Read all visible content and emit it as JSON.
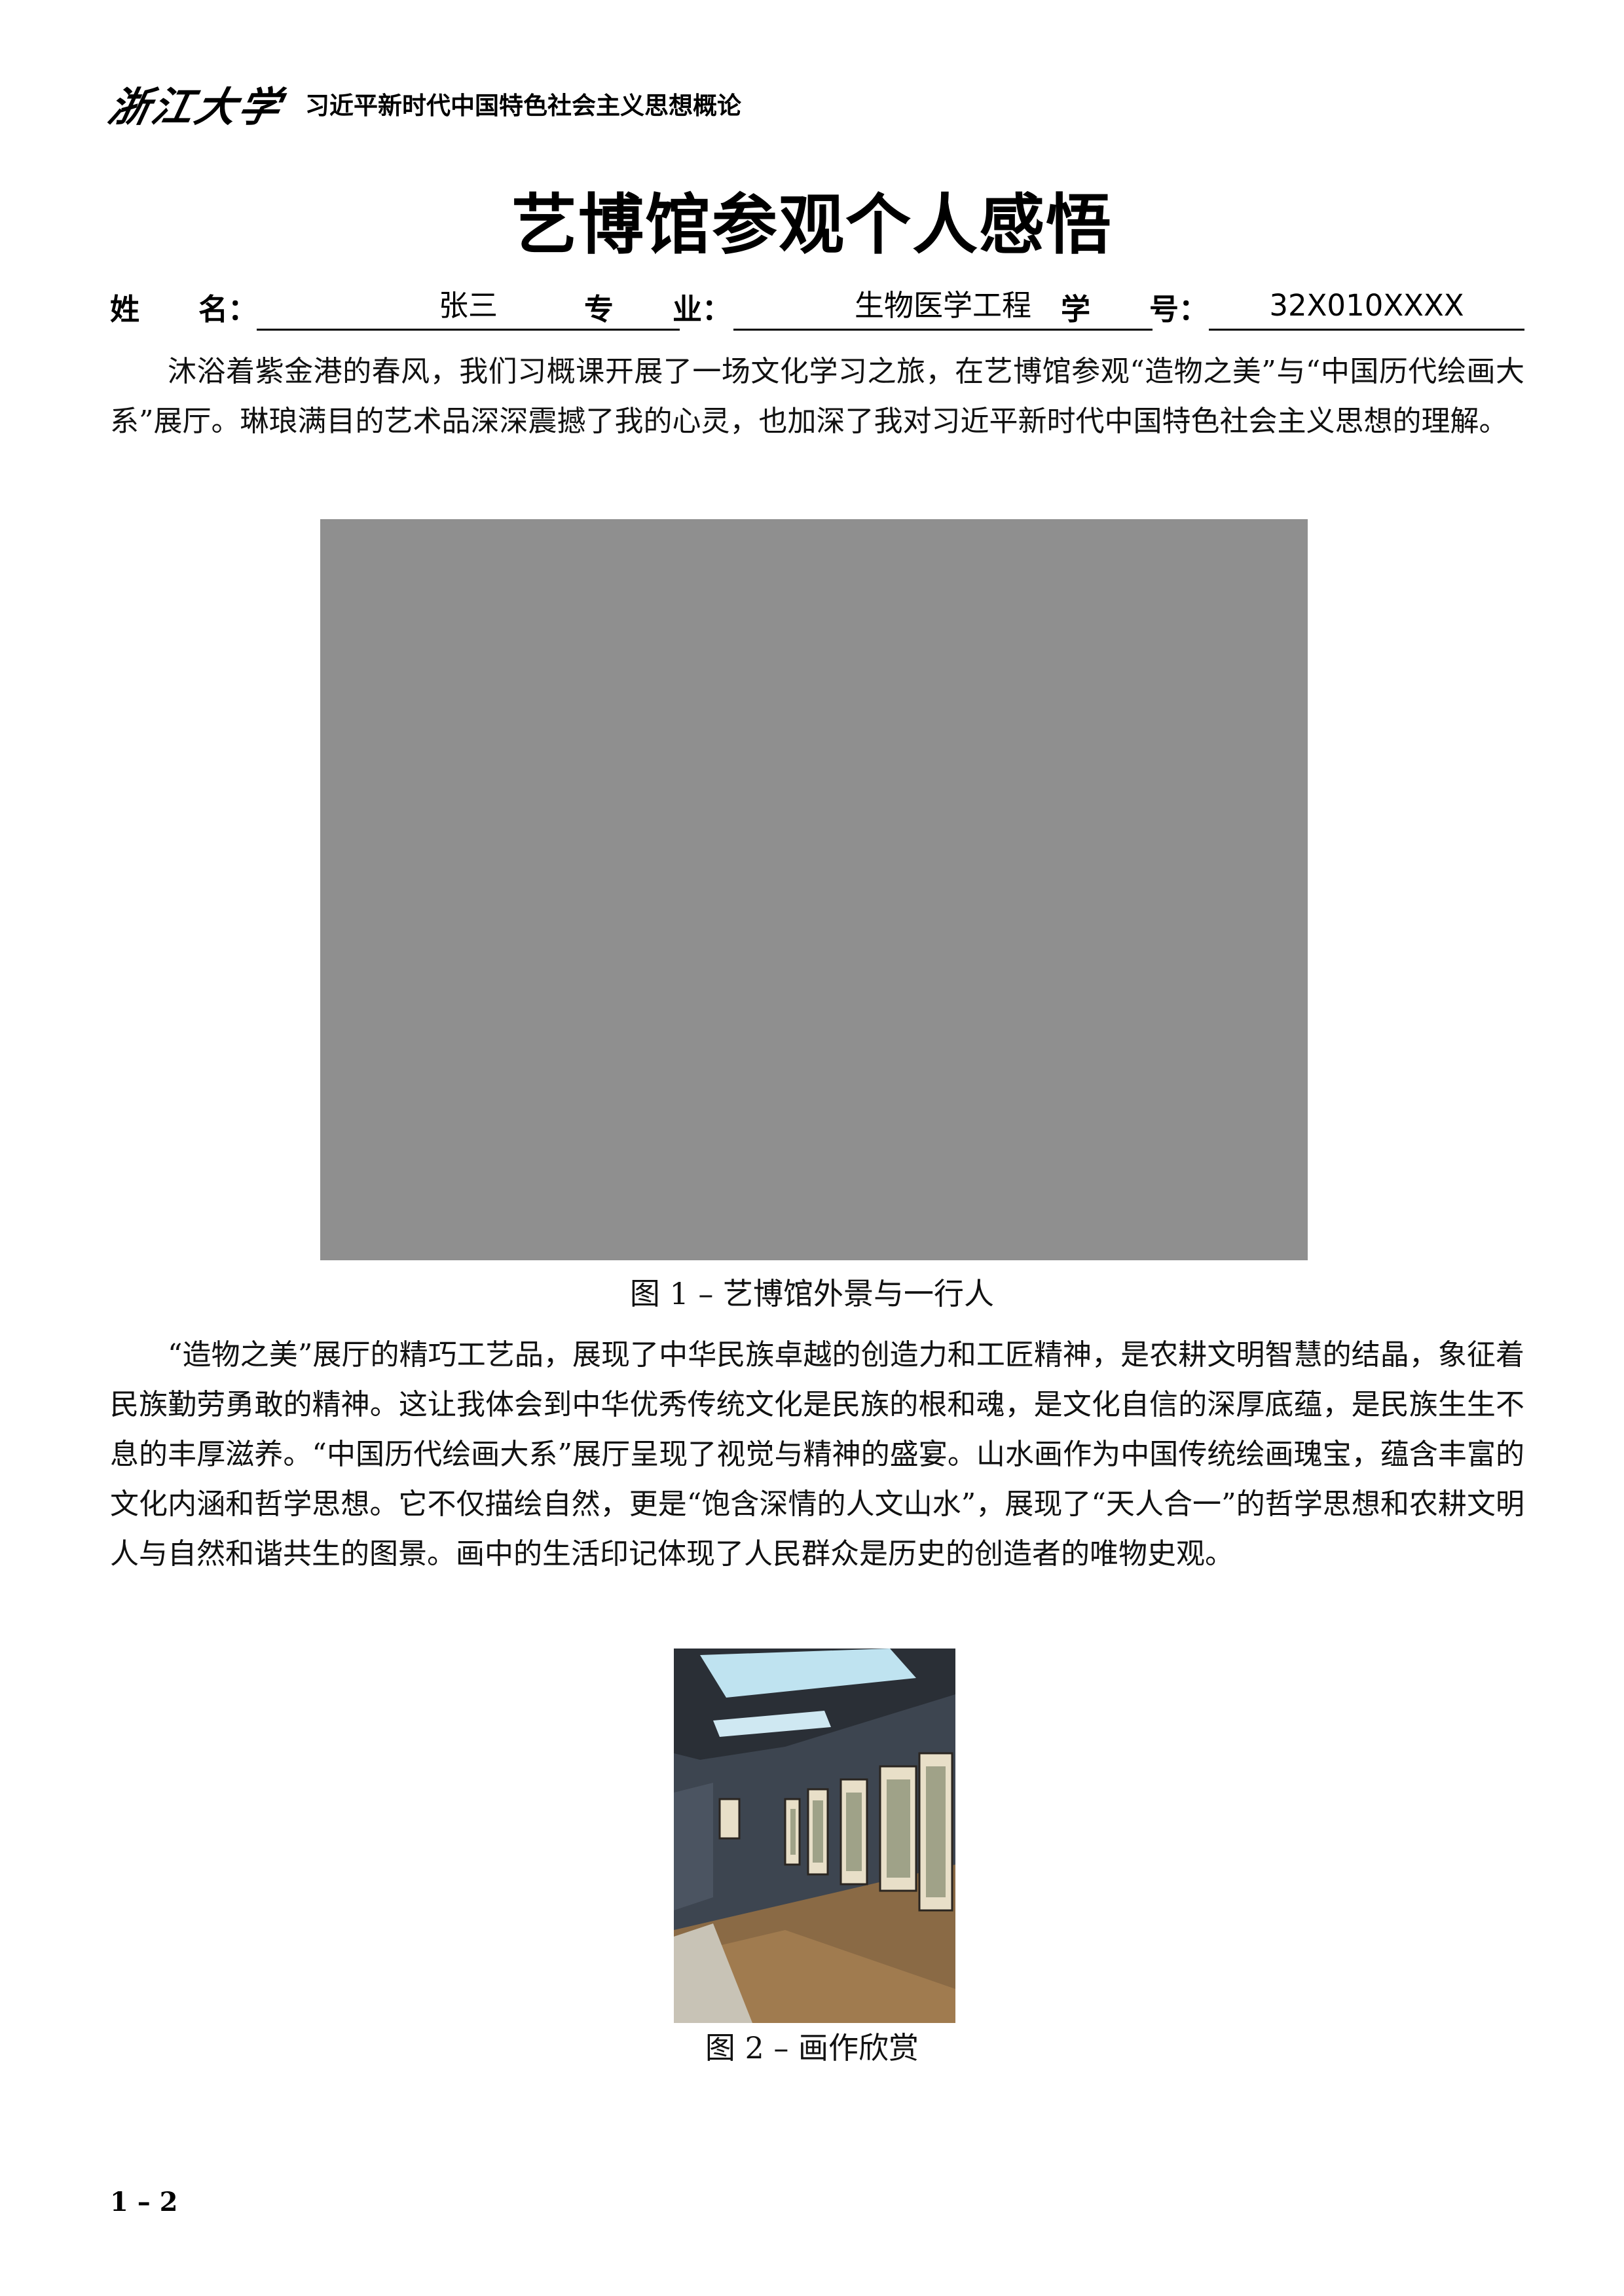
{
  "header": {
    "logo_text": "浙江大学",
    "course_title": "习近平新时代中国特色社会主义思想概论"
  },
  "title": "艺博馆参观个人感悟",
  "info": {
    "name_label": "姓　　名：",
    "name_value": "张三",
    "major_label": "专　　业：",
    "major_value": "生物医学工程",
    "id_label": "学　　号：",
    "id_value": "32X010XXXX"
  },
  "paragraphs": [
    "沐浴着紫金港的春风，我们习概课开展了一场文化学习之旅，在艺博馆参观“造物之美”与“中国历代绘画大系”展厅。琳琅满目的艺术品深深震撼了我的心灵，也加深了我对习近平新时代中国特色社会主义思想的理解。",
    "“造物之美”展厅的精巧工艺品，展现了中华民族卓越的创造力和工匠精神，是农耕文明智慧的结晶，象征着民族勤劳勇敢的精神。这让我体会到中华优秀传统文化是民族的根和魂，是文化自信的深厚底蕴，是民族生生不息的丰厚滋养。“中国历代绘画大系”展厅呈现了视觉与精神的盛宴。山水画作为中国传统绘画瑰宝，蕴含丰富的文化内涵和哲学思想。它不仅描绘自然，更是“饱含深情的人文山水”，展现了“天人合一”的哲学思想和农耕文明人与自然和谐共生的图景。画中的生活印记体现了人民群众是历史的创造者的唯物史观。"
  ],
  "figures": [
    {
      "caption": "图 1 – 艺博馆外景与一行人",
      "placeholder_color": "#8f8f8f"
    },
    {
      "caption": "图 2 – 画作欣赏"
    }
  ],
  "page_number": "1 – 2"
}
